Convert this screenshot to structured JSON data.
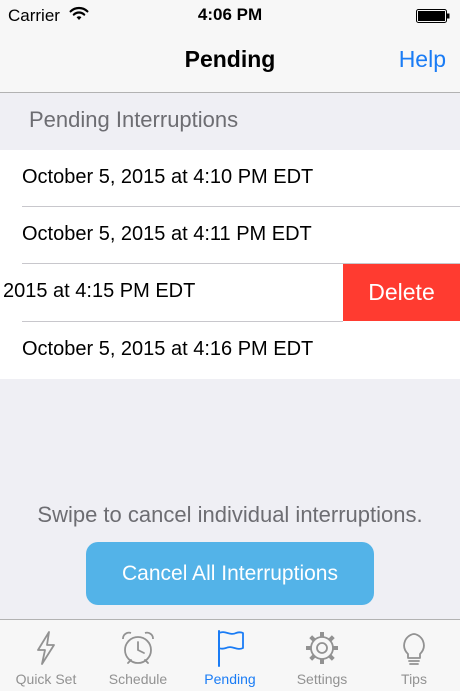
{
  "status_bar": {
    "carrier": "Carrier",
    "time": "4:06 PM"
  },
  "nav": {
    "title": "Pending",
    "help_label": "Help"
  },
  "section": {
    "title": "Pending Interruptions"
  },
  "rows": [
    {
      "text": "October 5, 2015 at 4:10 PM EDT"
    },
    {
      "text": "October 5, 2015 at 4:11 PM EDT"
    },
    {
      "text": "2015 at 4:15 PM EDT",
      "swiped": true
    },
    {
      "text": "October 5, 2015 at 4:16 PM EDT"
    }
  ],
  "delete_label": "Delete",
  "hint": "Swipe to cancel individual interruptions.",
  "cancel_all_label": "Cancel All Interruptions",
  "tabs": [
    {
      "label": "Quick Set",
      "icon": "lightning-icon"
    },
    {
      "label": "Schedule",
      "icon": "alarm-clock-icon"
    },
    {
      "label": "Pending",
      "icon": "flag-icon",
      "active": true
    },
    {
      "label": "Settings",
      "icon": "gear-icon"
    },
    {
      "label": "Tips",
      "icon": "lightbulb-icon"
    }
  ],
  "colors": {
    "accent": "#1a7cf5",
    "delete": "#ff3b30",
    "button": "#53b3e8"
  }
}
